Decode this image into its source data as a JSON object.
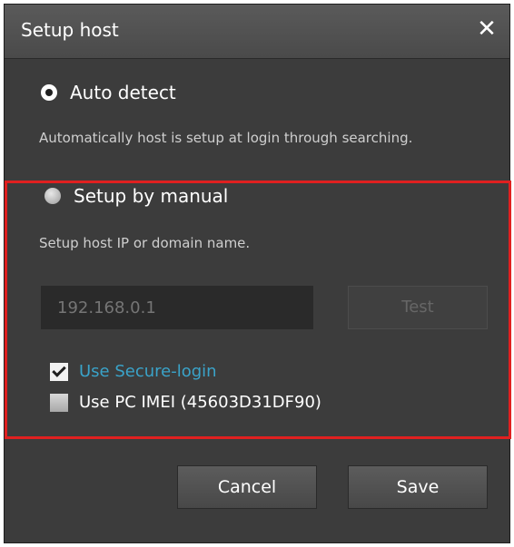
{
  "dialog": {
    "title": "Setup host",
    "close_glyph": "✕"
  },
  "auto_detect": {
    "label": "Auto detect",
    "selected": true,
    "description": "Automatically host is setup at login through searching."
  },
  "manual": {
    "label": "Setup by manual",
    "selected": false,
    "description": "Setup host IP or domain name.",
    "ip_placeholder": "192.168.0.1",
    "test_label": "Test"
  },
  "options": {
    "secure_login": {
      "label": "Use Secure-login",
      "checked": true
    },
    "pc_imei": {
      "label": "Use PC IMEI (45603D31DF90)",
      "checked": false
    }
  },
  "buttons": {
    "cancel": "Cancel",
    "save": "Save"
  },
  "colors": {
    "dialog_bg": "#3c3c3c",
    "highlight_border": "#e02020",
    "accent_text": "#3aa3c9"
  }
}
